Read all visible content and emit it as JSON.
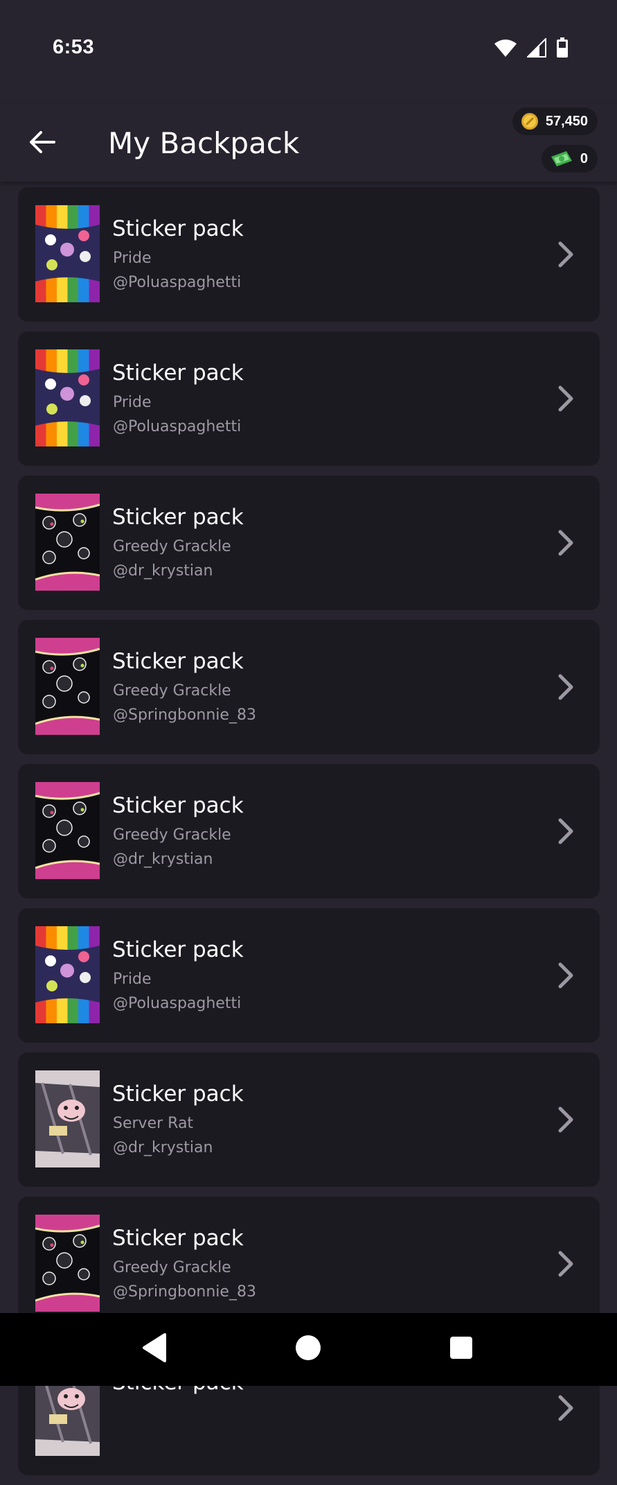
{
  "status_bar": {
    "time": "6:53"
  },
  "header": {
    "title": "My Backpack",
    "coins": "57,450",
    "cash": "0"
  },
  "colors": {
    "background": "#27242f",
    "card": "#1c1a21",
    "secondary_text": "#9c99a3"
  },
  "items": [
    {
      "title": "Sticker pack",
      "subtitle": "Pride",
      "user": "@Poluaspaghetti",
      "art": "pride"
    },
    {
      "title": "Sticker pack",
      "subtitle": "Pride",
      "user": "@Poluaspaghetti",
      "art": "pride"
    },
    {
      "title": "Sticker pack",
      "subtitle": "Greedy Grackle",
      "user": "@dr_krystian",
      "art": "grackle"
    },
    {
      "title": "Sticker pack",
      "subtitle": "Greedy Grackle",
      "user": "@Springbonnie_83",
      "art": "grackle"
    },
    {
      "title": "Sticker pack",
      "subtitle": "Greedy Grackle",
      "user": "@dr_krystian",
      "art": "grackle"
    },
    {
      "title": "Sticker pack",
      "subtitle": "Pride",
      "user": "@Poluaspaghetti",
      "art": "pride"
    },
    {
      "title": "Sticker pack",
      "subtitle": "Server Rat",
      "user": "@dr_krystian",
      "art": "rat"
    },
    {
      "title": "Sticker pack",
      "subtitle": "Greedy Grackle",
      "user": "@Springbonnie_83",
      "art": "grackle"
    },
    {
      "title": "Sticker pack",
      "subtitle": "",
      "user": "",
      "art": "rat"
    }
  ]
}
